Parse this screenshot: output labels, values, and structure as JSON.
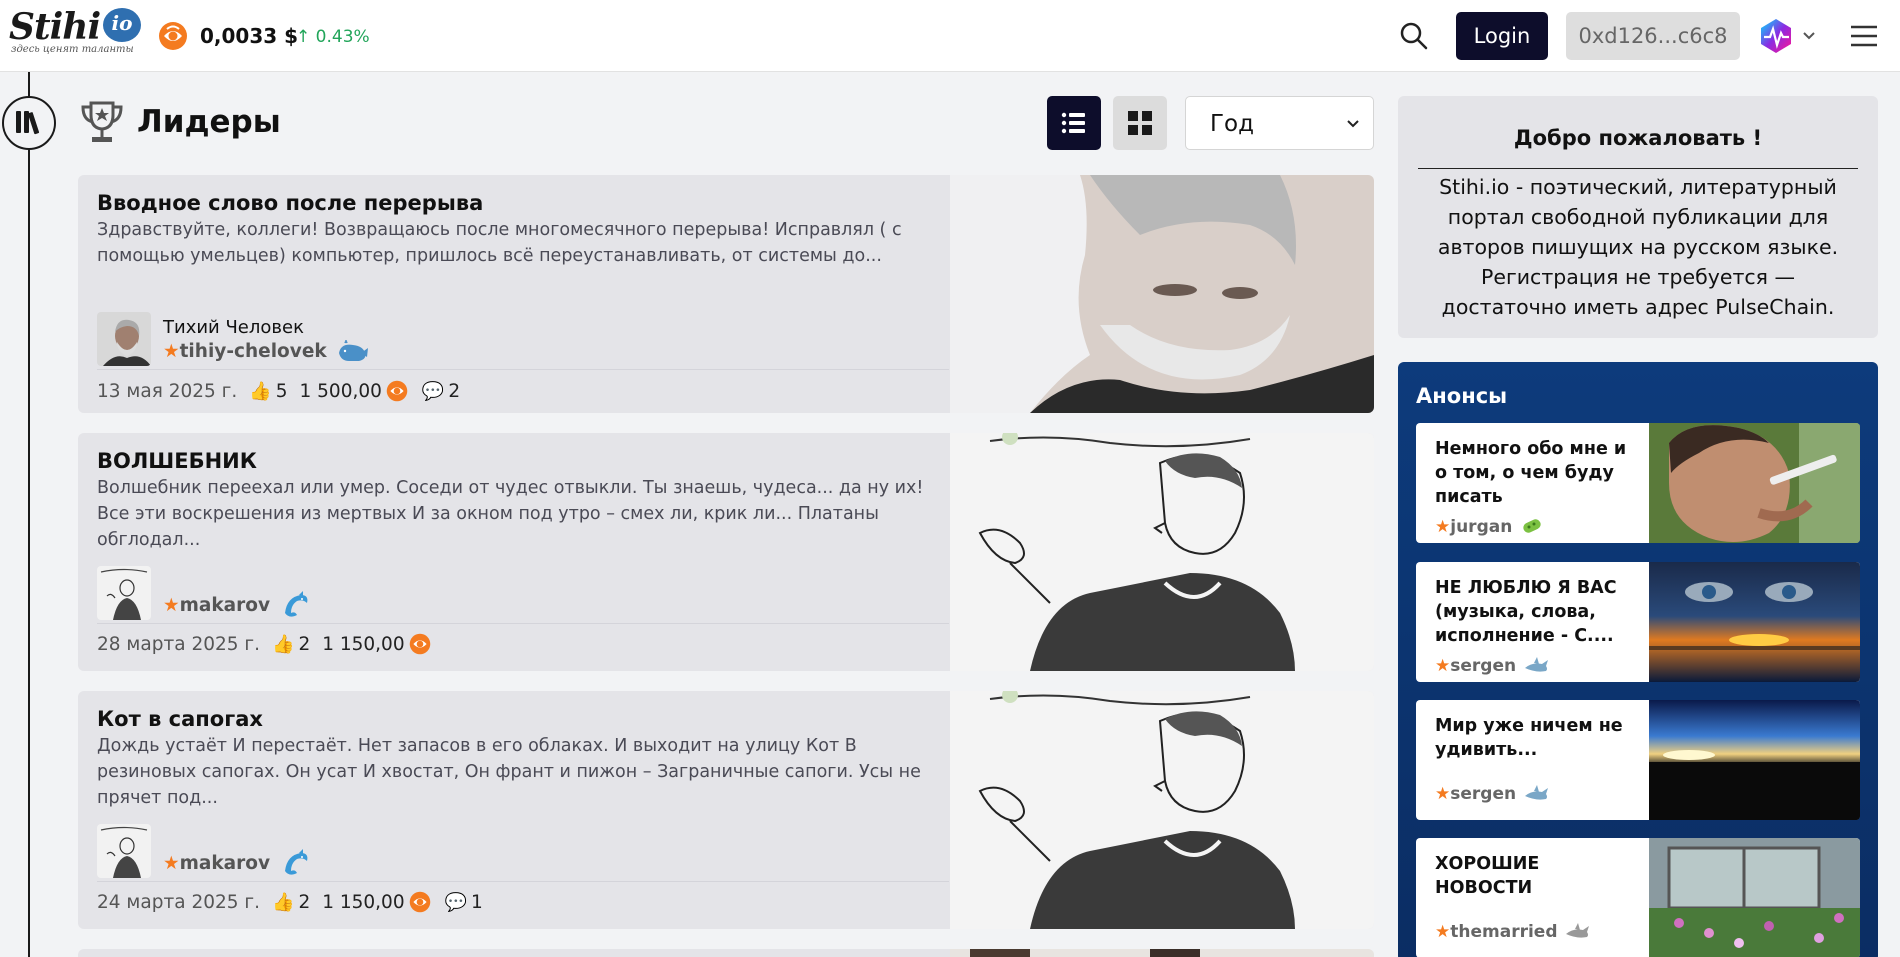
{
  "header": {
    "logo_text": "Stihi",
    "logo_suffix": "io",
    "logo_tagline": "здесь ценят таланты",
    "token_price": "0,0033 $",
    "price_change": "0.43%",
    "login_label": "Login",
    "wallet_address": "0xd126...c6c8"
  },
  "page": {
    "title": "Лидеры",
    "period_options": [
      "Год"
    ],
    "period_selected": "Год"
  },
  "posts": [
    {
      "title": "Вводное слово после перерыва",
      "excerpt": "Здравствуйте, коллеги! Возвращаюсь после многомесячного перерыва! Исправлял ( с помощью умельцев) компьютер, пришлось всё переустанавливать, от системы до...",
      "author_name": "Тихий Человек",
      "author_handle": "tihiy-chelovek",
      "author_rank_icon": "whale-icon",
      "date": "13 мая 2025 г.",
      "likes": "5",
      "amount": "1 500,00",
      "comments": "2"
    },
    {
      "title": "ВОЛШЕБНИК",
      "excerpt": "Волшебник переехал или умер. Соседи от чудес отвыкли. Ты знаешь, чудеса... да ну их! Все эти воскрешения из мертвых И за окном под утро – смех ли, крик ли... Платаны обглодал...",
      "author_name": "",
      "author_handle": "makarov",
      "author_rank_icon": "dolphin-icon",
      "date": "28 марта 2025 г.",
      "likes": "2",
      "amount": "1 150,00",
      "comments": ""
    },
    {
      "title": "Кот в сапогах",
      "excerpt": "Дождь устаёт И перестаёт. Нет запасов в его облаках. И выходит на улицу Кот В резиновых сапогах. Он усат И хвостат, Он франт и пижон – Заграничные сапоги. Усы не прячет под...",
      "author_name": "",
      "author_handle": "makarov",
      "author_rank_icon": "dolphin-icon",
      "date": "24 марта 2025 г.",
      "likes": "2",
      "amount": "1 150,00",
      "comments": "1"
    }
  ],
  "welcome": {
    "title": "Добро пожаловать !",
    "text": "Stihi.io - поэтический, литературный портал свободной публикации для авторов пишущих на русском языке. Регистрация не требуется — достаточно иметь адрес PulseChain."
  },
  "announcements": {
    "title": "Анонсы",
    "items": [
      {
        "title": "Немного обо мне и о том, о чем буду писать",
        "author": "jurgan",
        "rank_icon": "bacteria-icon"
      },
      {
        "title": "НЕ ЛЮБЛЮ Я ВАС (музыка, слова, исполнение - С....",
        "author": "sergen",
        "rank_icon": "shark-icon"
      },
      {
        "title": "Мир уже ничем не удивить...",
        "author": "sergen",
        "rank_icon": "shark-icon"
      },
      {
        "title": "ХОРОШИЕ НОВОСТИ",
        "author": "themarried",
        "rank_icon": "shark-icon"
      }
    ]
  },
  "colors": {
    "accent_dark": "#0d0d2b",
    "token_orange": "#f47b20",
    "positive_green": "#22a55a",
    "announcements_blue": "#0d3b7c"
  }
}
